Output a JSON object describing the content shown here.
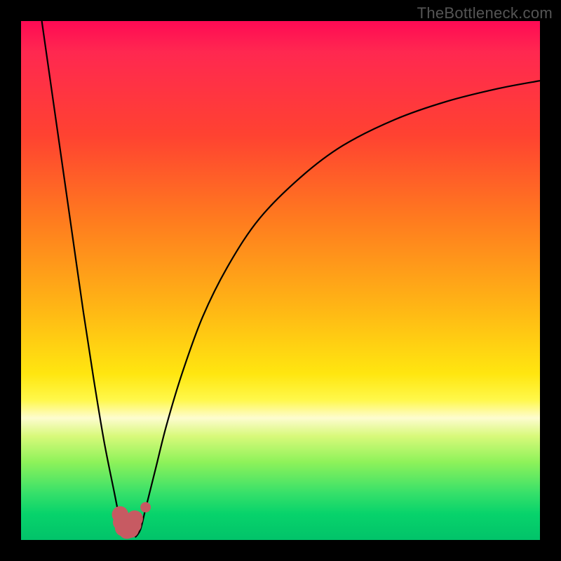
{
  "attribution": "TheBottleneck.com",
  "colors": {
    "frame": "#000000",
    "gradient_top": "#ff0a54",
    "gradient_mid1": "#ff7a1f",
    "gradient_mid2": "#ffe610",
    "gradient_pale": "#fdfccf",
    "gradient_bottom": "#02c36a",
    "curve": "#000000",
    "marker": "#c75a62"
  },
  "chart_data": {
    "type": "line",
    "title": "",
    "xlabel": "",
    "ylabel": "",
    "xlim": [
      0,
      100
    ],
    "ylim": [
      0,
      100
    ],
    "series": [
      {
        "name": "left-branch",
        "x": [
          4,
          6,
          8,
          10,
          12,
          14,
          16,
          18,
          19,
          19.6,
          20
        ],
        "values": [
          100,
          86,
          72,
          58,
          44,
          31,
          19,
          9,
          4,
          1.5,
          0.5
        ]
      },
      {
        "name": "right-branch",
        "x": [
          22,
          23,
          24,
          26,
          28,
          31,
          35,
          40,
          46,
          54,
          62,
          72,
          82,
          92,
          100
        ],
        "values": [
          0.5,
          2,
          6,
          14,
          22,
          32,
          43,
          53,
          62,
          70,
          76,
          81,
          84.5,
          87,
          88.5
        ]
      }
    ],
    "markers": {
      "name": "highlight-dots",
      "color": "#c75a62",
      "points": [
        {
          "x": 19.1,
          "y": 4.9,
          "r": 1.6
        },
        {
          "x": 19.3,
          "y": 3.4,
          "r": 1.6
        },
        {
          "x": 19.7,
          "y": 2.3,
          "r": 1.6
        },
        {
          "x": 20.4,
          "y": 1.8,
          "r": 1.6
        },
        {
          "x": 21.1,
          "y": 2.0,
          "r": 1.6
        },
        {
          "x": 21.6,
          "y": 2.9,
          "r": 1.6
        },
        {
          "x": 21.9,
          "y": 4.1,
          "r": 1.6
        },
        {
          "x": 24.0,
          "y": 6.3,
          "r": 1.0
        }
      ]
    }
  }
}
